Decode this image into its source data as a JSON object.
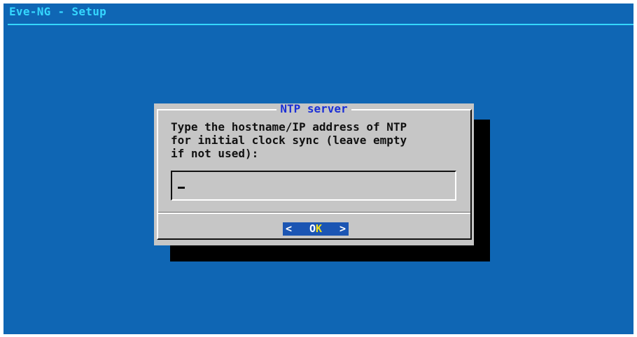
{
  "window": {
    "backtitle": "Eve-NG - Setup"
  },
  "dialog": {
    "title": "NTP server",
    "prompt": "Type the hostname/IP address of NTP\nfor initial clock sync (leave empty\nif not used):",
    "input": {
      "value": ""
    },
    "ok_button": {
      "left_arrow": "<",
      "label_main": "O",
      "label_hotkey": "K",
      "right_arrow": ">"
    }
  },
  "colors": {
    "background": "#0f66b4",
    "backtitle": "#35d7ff",
    "dialog": "#c6c6c6",
    "dialog_title": "#1b2fd6",
    "button_bg": "#1b55b3",
    "hotkey": "#f2e21a"
  }
}
